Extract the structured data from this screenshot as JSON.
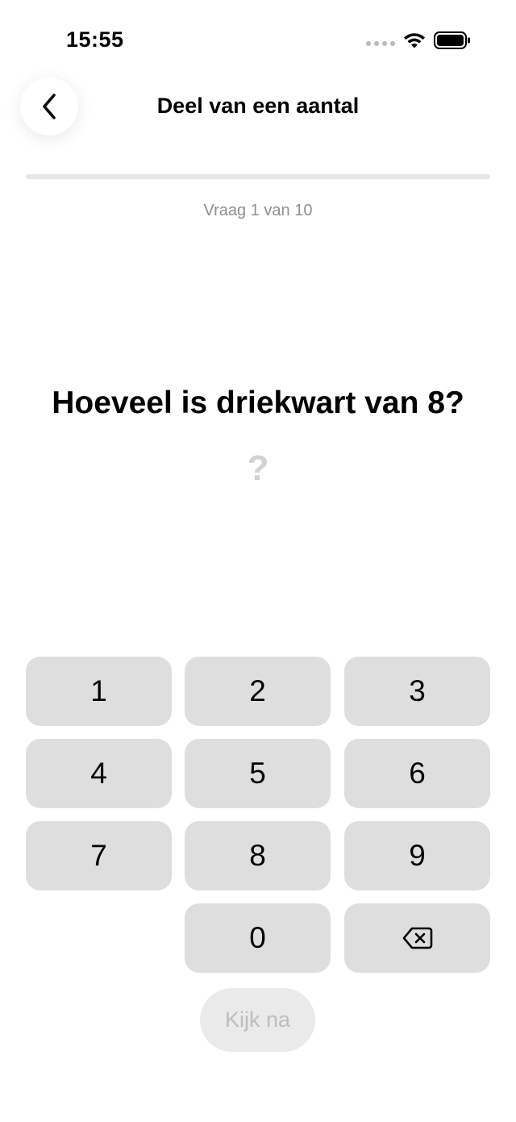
{
  "status_bar": {
    "time": "15:55"
  },
  "header": {
    "title": "Deel van een aantal",
    "back_icon": "chevron-left-icon"
  },
  "progress": {
    "fraction": 0,
    "fill_color": "#1a73e8",
    "track_color": "#e6e6e6"
  },
  "quiz": {
    "counter": "Vraag 1 van 10",
    "question": "Hoeveel is driekwart van 8?",
    "answer_placeholder": "?"
  },
  "keypad": {
    "keys": [
      "1",
      "2",
      "3",
      "4",
      "5",
      "6",
      "7",
      "8",
      "9",
      "0"
    ],
    "backspace_icon": "backspace-icon"
  },
  "actions": {
    "check_label": "Kijk na"
  },
  "colors": {
    "key_background": "#dedede",
    "disabled_button": "#eaeaea",
    "disabled_text": "#bdbdbd",
    "muted_text": "#8e8e93"
  }
}
